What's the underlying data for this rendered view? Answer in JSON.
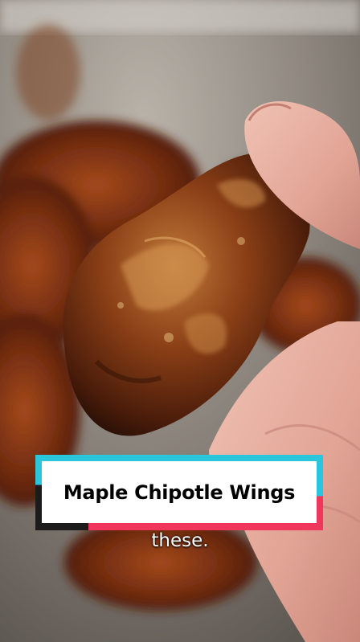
{
  "overlay": {
    "title": "Maple Chipotle Wings",
    "caption": "these."
  },
  "colors": {
    "title_border_cyan": "#29c6dc",
    "title_border_pink": "#f0365b",
    "title_plate": "#ffffff",
    "caption_text": "#ffffff"
  }
}
